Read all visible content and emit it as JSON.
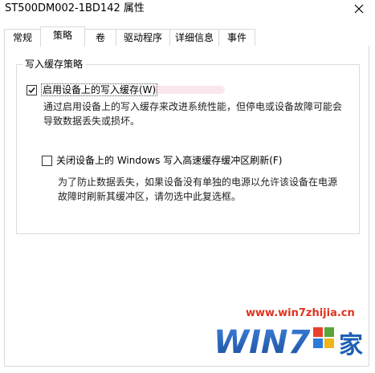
{
  "window": {
    "title": "ST500DM002-1BD142 属性"
  },
  "tabs": [
    {
      "label": "常规"
    },
    {
      "label": "策略"
    },
    {
      "label": "卷"
    },
    {
      "label": "驱动程序"
    },
    {
      "label": "详细信息"
    },
    {
      "label": "事件"
    }
  ],
  "active_tab": "策略",
  "group": {
    "title": "写入缓存策略",
    "option1": {
      "label": "启用设备上的写入缓存(W)",
      "checked": true,
      "description_line1": "通过启用设备上的写入缓存来改进系统性能，但停电或设备故障可能会",
      "description_line2": "导致数据丢失或损坏。"
    },
    "option2": {
      "label": "关闭设备上的 Windows 写入高速缓存缓冲区刷新(F)",
      "checked": false,
      "description_line1": "为了防止数据丢失，如果设备没有单独的电源以允许该设备在电源",
      "description_line2": "故障时刷新其缓冲区，请勿选中此复选框。"
    }
  },
  "watermark": {
    "url": "www.win7zhijia.cn",
    "logo_text": "WIN7",
    "logo_suffix": "家"
  },
  "colors": {
    "watermark_red": "#e0321e",
    "watermark_blue": "#1f5fb4",
    "border": "#d9d9d9"
  },
  "icons": {
    "close": "close-icon",
    "check": "checkmark-icon"
  }
}
